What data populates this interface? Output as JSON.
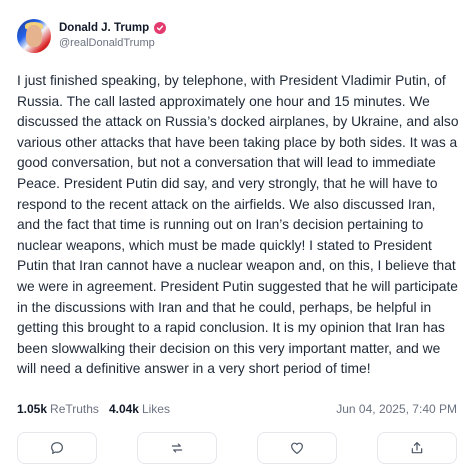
{
  "author": {
    "display_name": "Donald J. Trump",
    "handle": "@realDonaldTrump"
  },
  "post": {
    "text": "I just finished speaking, by telephone, with President Vladimir Putin, of Russia. The call lasted approximately one hour and 15 minutes. We discussed the attack on Russia’s docked airplanes, by Ukraine, and also various other attacks that have been taking place by both sides. It was a good conversation, but not a conversation that will lead to immediate Peace. President Putin did say, and very strongly, that he will have to respond to the recent attack on the airfields. We also discussed Iran, and the fact that time is running out on Iran’s decision pertaining to nuclear weapons, which must be made quickly! I stated to President Putin that Iran cannot have a nuclear weapon and, on this, I believe that we were in agreement. President Putin suggested that he will participate in the discussions with Iran and that he could, perhaps, be helpful in getting this brought to a rapid conclusion. It is my opinion that Iran has been slowwalking their decision on this very important matter, and we will need a definitive answer in a very short period of time!",
    "retruths_count": "1.05k",
    "retruths_label": "ReTruths",
    "likes_count": "4.04k",
    "likes_label": "Likes",
    "timestamp": "Jun 04, 2025, 7:40 PM"
  },
  "actions": [
    {
      "name": "reply",
      "icon": "comment-icon"
    },
    {
      "name": "retruth",
      "icon": "repost-icon"
    },
    {
      "name": "like",
      "icon": "heart-icon"
    },
    {
      "name": "share",
      "icon": "share-icon"
    }
  ],
  "colors": {
    "verified_badge": "#e43b6f",
    "text": "#1f2937",
    "muted": "#6b7280",
    "border": "#e5e7eb"
  }
}
